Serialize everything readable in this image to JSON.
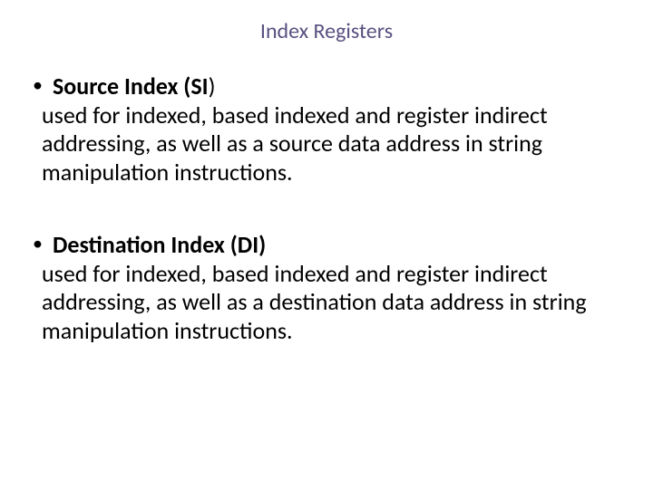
{
  "title": "Index Registers",
  "items": [
    {
      "label": "Source Index (SI",
      "paren_close": ")",
      "desc": "used for indexed, based indexed and register indirect addressing, as well as a source data address in string manipulation instructions."
    },
    {
      "label": "Destination Index (DI)",
      "paren_close": "",
      "desc": "used for indexed, based indexed and register indirect addressing, as well as a destination data address in string manipulation instructions."
    }
  ]
}
